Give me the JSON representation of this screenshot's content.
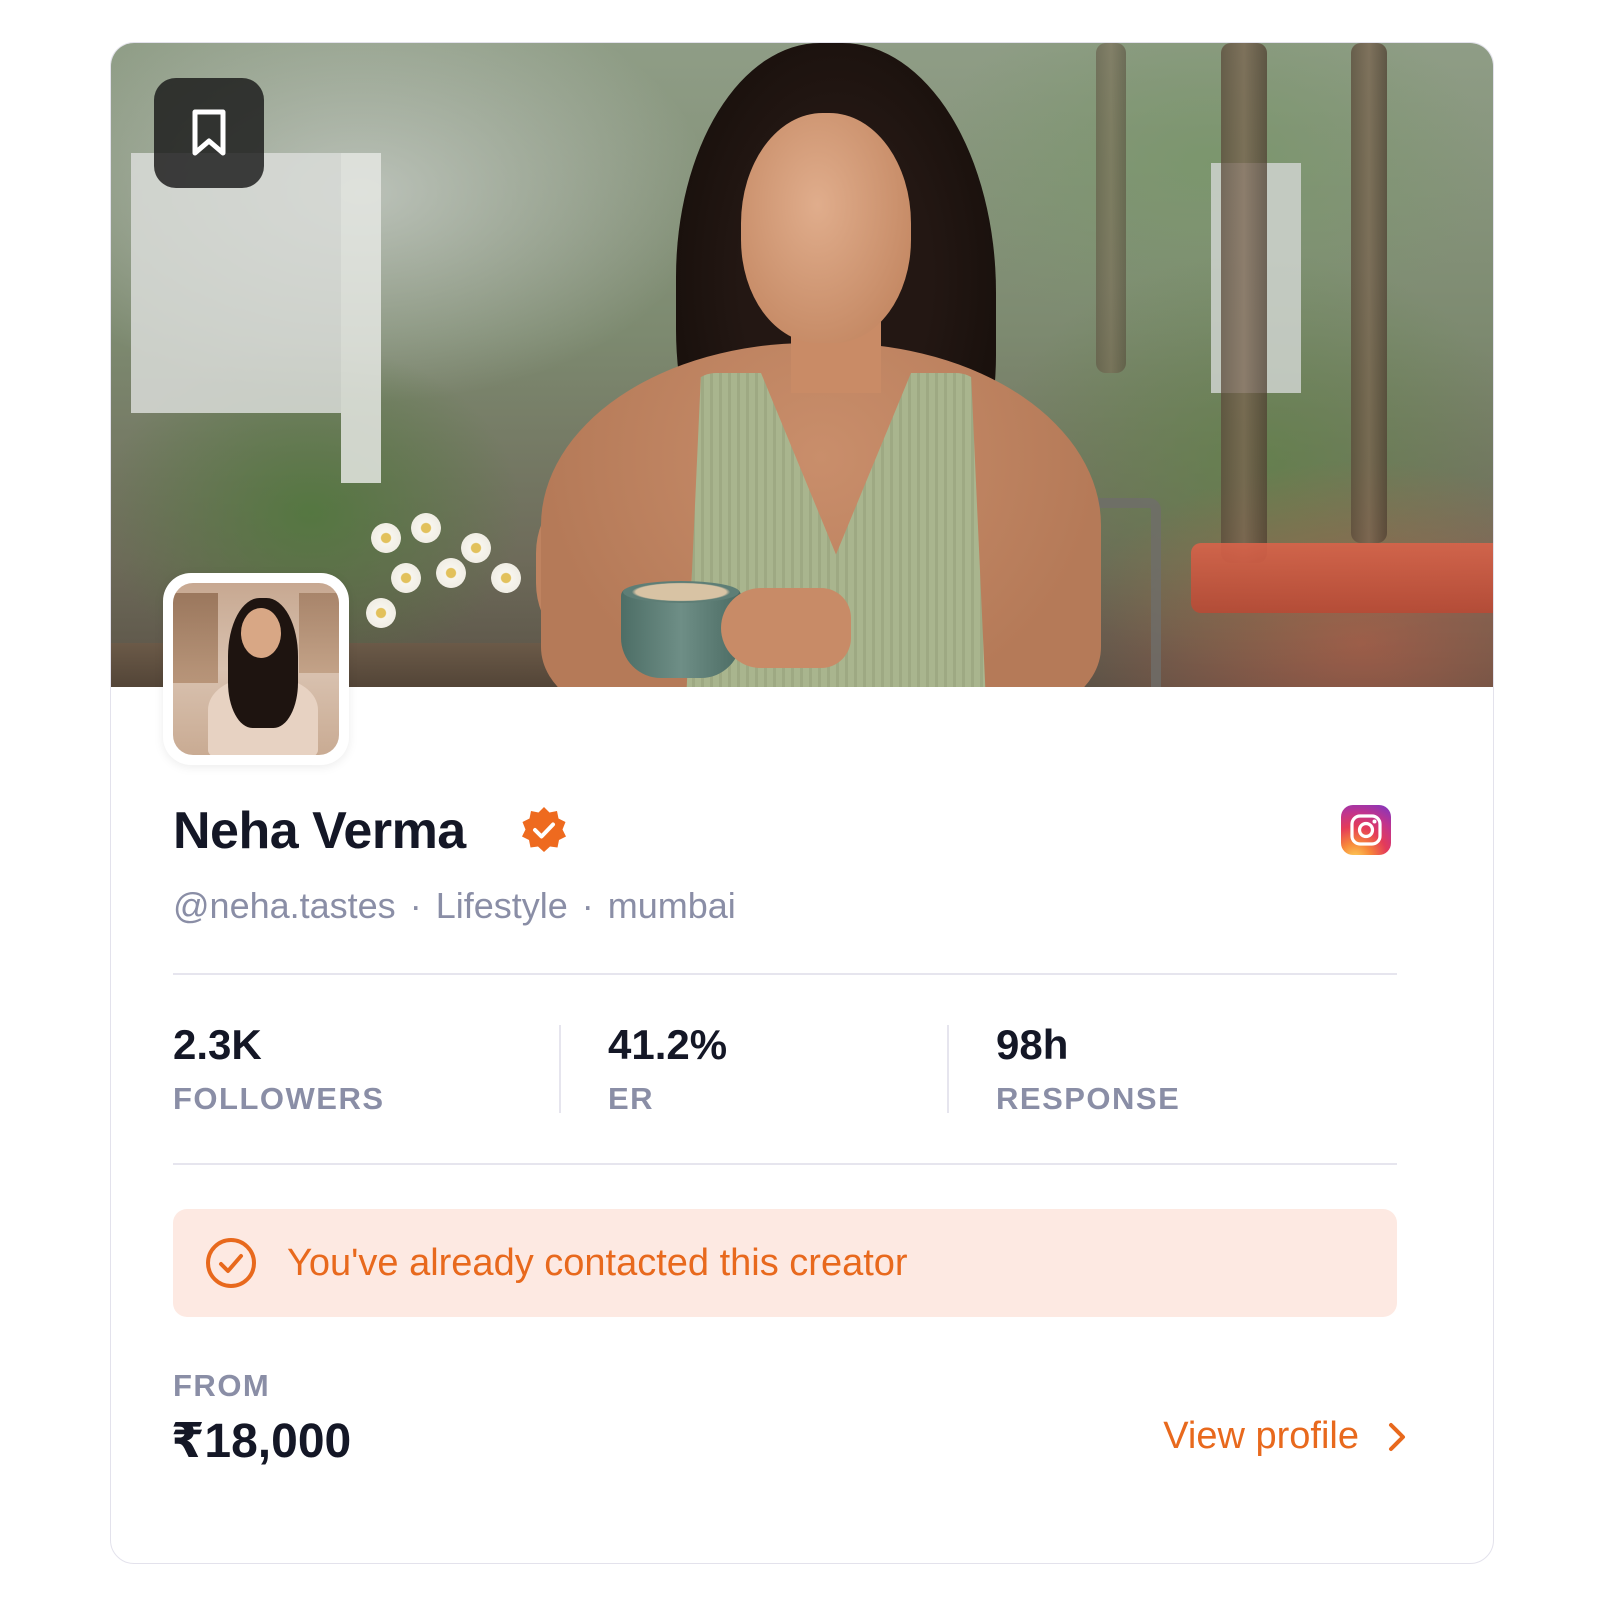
{
  "card": {
    "cover_alt": "Creator cover photo",
    "bookmark_icon": "bookmark-icon",
    "avatar_icon": "avatar-photo"
  },
  "profile": {
    "name": "Neha Verma",
    "verified": true,
    "handle": "@neha.tastes",
    "category": "Lifestyle",
    "city": "mumbai",
    "separator": "·",
    "platform_icon": "instagram-icon"
  },
  "stats": [
    {
      "value": "2.3K",
      "label": "FOLLOWERS"
    },
    {
      "value": "41.2%",
      "label": "ER"
    },
    {
      "value": "98h",
      "label": "RESPONSE"
    }
  ],
  "notice": {
    "icon": "check-circle-icon",
    "text": "You've already contacted this creator"
  },
  "pricing": {
    "from_label": "FROM",
    "price": "₹18,000"
  },
  "actions": {
    "view_profile": "View profile",
    "view_profile_icon": "chevron-right-icon"
  },
  "colors": {
    "accent": "#e8691d",
    "notice_bg": "#fde9e2",
    "text_primary": "#141726",
    "text_muted": "#8a8ea6",
    "verified_badge": "#ee6a1f"
  }
}
